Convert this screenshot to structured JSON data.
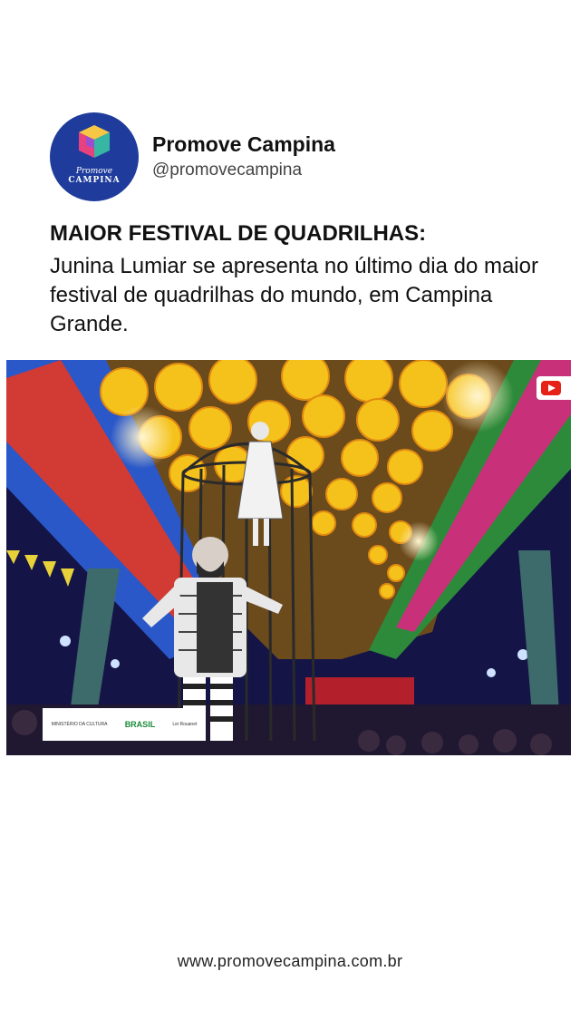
{
  "profile": {
    "display_name": "Promove Campina",
    "handle": "@promovecampina",
    "avatar_text_line1": "Promove",
    "avatar_text_line2": "CAMPINA"
  },
  "post": {
    "headline": "MAIOR FESTIVAL DE QUADRILHAS:",
    "body": "Junina Lumiar se apresenta no último dia do maior festival de quadrilhas do mundo, em Campina Grande."
  },
  "media": {
    "sponsor_labels": [
      "MINISTÉRIO DA CULTURA",
      "BRASIL",
      "Lei Rouanet"
    ]
  },
  "footer": {
    "url": "www.promovecampina.com.br"
  },
  "colors": {
    "avatar_bg": "#1f3c9c",
    "youtube_red": "#e62117"
  }
}
